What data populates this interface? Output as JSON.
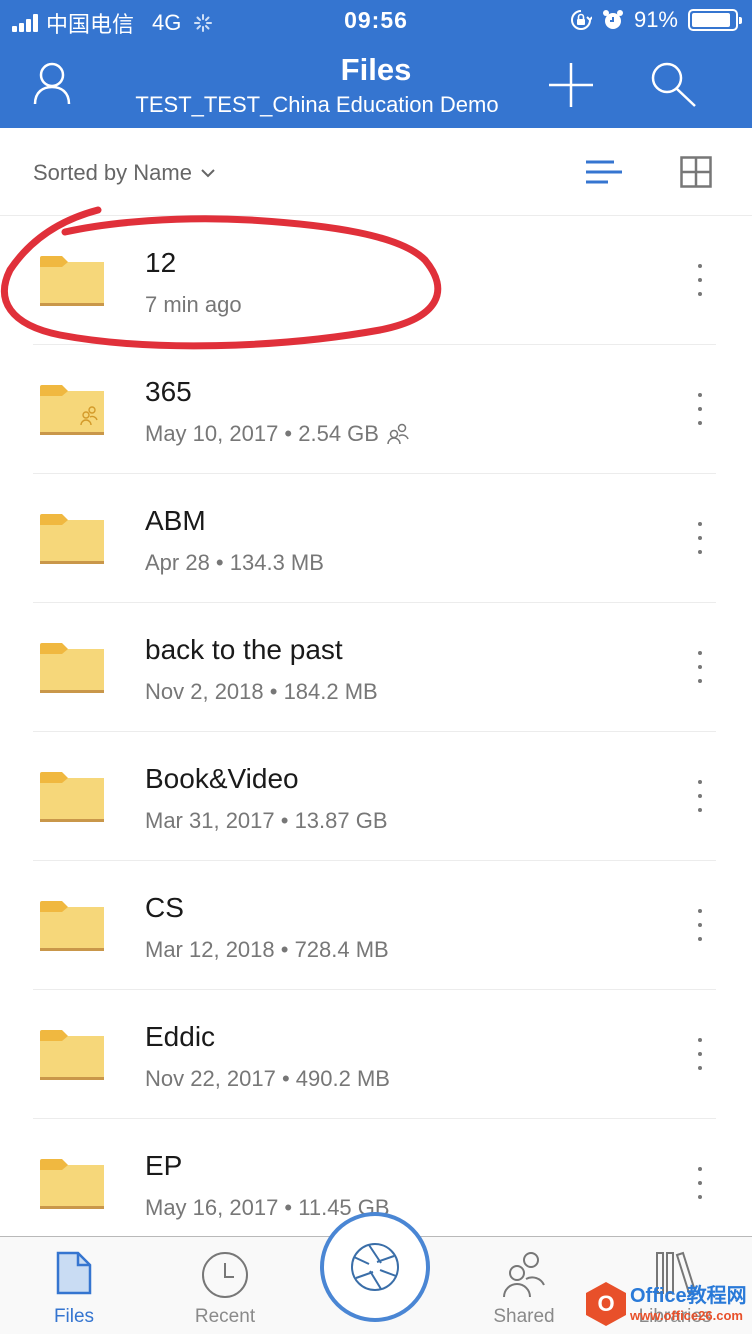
{
  "status_bar": {
    "carrier": "中国电信",
    "network": "4G",
    "time": "09:56",
    "battery_percent": "91%",
    "battery_level": 0.91
  },
  "header": {
    "title": "Files",
    "subtitle": "TEST_TEST_China Education Demo",
    "icons": [
      "account-icon",
      "add-icon",
      "search-icon"
    ]
  },
  "sort": {
    "label": "Sorted by Name",
    "view_modes": [
      "list-view",
      "grid-view"
    ],
    "active_view": "list-view"
  },
  "files": [
    {
      "name": "12",
      "meta": "7 min ago",
      "shared": false,
      "annotated": true
    },
    {
      "name": "365",
      "meta": "May 10, 2017 • 2.54 GB",
      "shared": true,
      "annotated": false
    },
    {
      "name": "ABM",
      "meta": "Apr 28 • 134.3 MB",
      "shared": false,
      "annotated": false
    },
    {
      "name": "back to the past",
      "meta": "Nov 2, 2018 • 184.2 MB",
      "shared": false,
      "annotated": false
    },
    {
      "name": "Book&Video",
      "meta": "Mar 31, 2017 • 13.87 GB",
      "shared": false,
      "annotated": false
    },
    {
      "name": "CS",
      "meta": "Mar 12, 2018 • 728.4 MB",
      "shared": false,
      "annotated": false
    },
    {
      "name": "Eddic",
      "meta": "Nov 22, 2017 • 490.2 MB",
      "shared": false,
      "annotated": false
    },
    {
      "name": "EP",
      "meta": "May 16, 2017 • 11.45 GB",
      "shared": false,
      "annotated": false
    }
  ],
  "tabs": [
    {
      "label": "Files",
      "active": true
    },
    {
      "label": "Recent",
      "active": false
    },
    {
      "label": "Shared",
      "active": false
    },
    {
      "label": "Libraries",
      "active": false
    }
  ],
  "watermark": {
    "logo_letter": "O",
    "line1": "Office教程网",
    "line2": "www.office26.com"
  },
  "colors": {
    "accent": "#3575d0",
    "folder": "#f6d77a",
    "folder_tab": "#f0b840",
    "annotation": "#e0303a"
  }
}
